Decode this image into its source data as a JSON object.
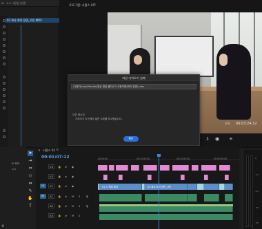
{
  "source_panel": {
    "close_icon": "×",
    "tab_label": "소스: (클립 없음)",
    "clip_label": "03 회사 회의 장면_고민.MOV"
  },
  "program_monitor": {
    "tab_label": "프로그램: 시퀀스 01",
    "menu_icon": "≡",
    "fit_label": "전체",
    "timecode": "00:03:24:12"
  },
  "dialog": {
    "title": "파일 가져오기 실패",
    "path": "/사용자/mac/Movies/영상 편집 폴더/03 사용자면(회의 장면).mov",
    "error_label": "오류 메시지",
    "error_message": "가져오기 도구에서 일반 오류를 보고했습니다.",
    "ok_label": "확인"
  },
  "project_panel": {
    "clip_label": "16 항목",
    "size_label": "1/3"
  },
  "timeline": {
    "tab_close": "×",
    "tab_label": "시퀀스 01",
    "menu_icon": "≡",
    "timecode": "00:01:07:12",
    "ruler_labels": [
      "00:00:00",
      "00:01:00:00",
      "00:02:00:00",
      "00:03:00:00"
    ],
    "tracks": [
      {
        "name": "V3",
        "src": ""
      },
      {
        "name": "V2",
        "src": ""
      },
      {
        "name": "V1",
        "src": "V1"
      },
      {
        "name": "A1",
        "src": "A1"
      },
      {
        "name": "A2",
        "src": ""
      },
      {
        "name": "A3",
        "src": ""
      }
    ],
    "clip_labels": {
      "v1_a": "01 스 책상 회의",
      "v1_b": "03 회사 회의 장면_고민"
    }
  },
  "meter": {
    "scale": [
      "0",
      "-12",
      "-24",
      "-36",
      "-48"
    ]
  },
  "status": {
    "icon": "⚙"
  }
}
